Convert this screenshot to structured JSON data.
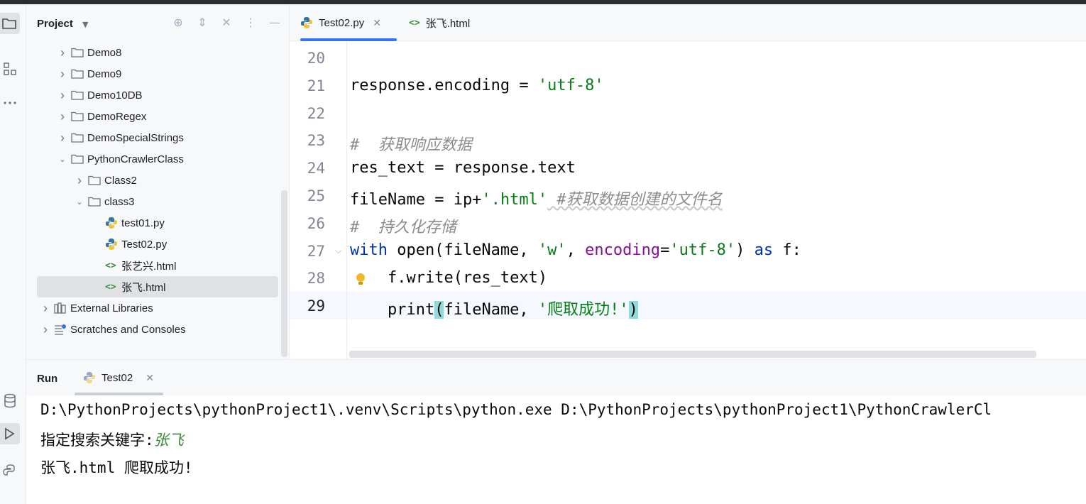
{
  "project": {
    "title": "Project",
    "tree": [
      {
        "label": "Demo8",
        "level": 1,
        "kind": "folder",
        "expanded": false
      },
      {
        "label": "Demo9",
        "level": 1,
        "kind": "folder",
        "expanded": false
      },
      {
        "label": "Demo10DB",
        "level": 1,
        "kind": "folder",
        "expanded": false
      },
      {
        "label": "DemoRegex",
        "level": 1,
        "kind": "folder",
        "expanded": false
      },
      {
        "label": "DemoSpecialStrings",
        "level": 1,
        "kind": "folder",
        "expanded": false
      },
      {
        "label": "PythonCrawlerClass",
        "level": 1,
        "kind": "folder",
        "expanded": true
      },
      {
        "label": "Class2",
        "level": 2,
        "kind": "folder",
        "expanded": false
      },
      {
        "label": "class3",
        "level": 2,
        "kind": "folder",
        "expanded": true
      },
      {
        "label": "test01.py",
        "level": 3,
        "kind": "python"
      },
      {
        "label": "Test02.py",
        "level": 3,
        "kind": "python"
      },
      {
        "label": "张艺兴.html",
        "level": 3,
        "kind": "html"
      },
      {
        "label": "张飞.html",
        "level": 3,
        "kind": "html",
        "selected": true
      },
      {
        "label": "External Libraries",
        "level": 0,
        "kind": "library",
        "expanded": false
      },
      {
        "label": "Scratches and Consoles",
        "level": 0,
        "kind": "scratch",
        "expanded": false
      }
    ]
  },
  "editor": {
    "tabs": [
      {
        "label": "Test02.py",
        "active": true,
        "closable": true
      },
      {
        "label": "张飞.html",
        "active": false
      }
    ],
    "line_numbers": [
      "20",
      "21",
      "22",
      "23",
      "24",
      "25",
      "26",
      "27",
      "28",
      "29"
    ],
    "current_line": "29",
    "code": {
      "l21_a": "response.encoding = ",
      "l21_b": "'utf-8'",
      "l23": "#  获取响应数据",
      "l24": "res_text = response.text",
      "l25_a": "fileName = ip+",
      "l25_b": "'.html'",
      "l25_c": " #获取数据创建的文件名",
      "l26": "#  持久化存储",
      "l27_kw1": "with",
      "l27_a": " open(fileName, ",
      "l27_b": "'w'",
      "l27_c": ", ",
      "l27_par": "encoding",
      "l27_d": "=",
      "l27_e": "'utf-8'",
      "l27_f": ") ",
      "l27_kw2": "as",
      "l27_g": " f:",
      "l28": "    f.write(res_text)",
      "l29_a": "    print",
      "l29_b": "(",
      "l29_c": "fileName, ",
      "l29_d": "'爬取成功!'",
      "l29_e": ")"
    }
  },
  "run": {
    "title": "Run",
    "tab_label": "Test02",
    "console": {
      "line1": "D:\\PythonProjects\\pythonProject1\\.venv\\Scripts\\python.exe D:\\PythonProjects\\pythonProject1\\PythonCrawlerCl",
      "line2_prompt": "指定搜索关键字:",
      "line2_input": "张飞",
      "line3": "张飞.html 爬取成功!"
    }
  },
  "colors": {
    "accent": "#3574f0",
    "keyword": "#0033b3",
    "string": "#067d17",
    "comment": "#8c8c8c",
    "param": "#871094",
    "bracket_highlight": "#93d9d9"
  }
}
